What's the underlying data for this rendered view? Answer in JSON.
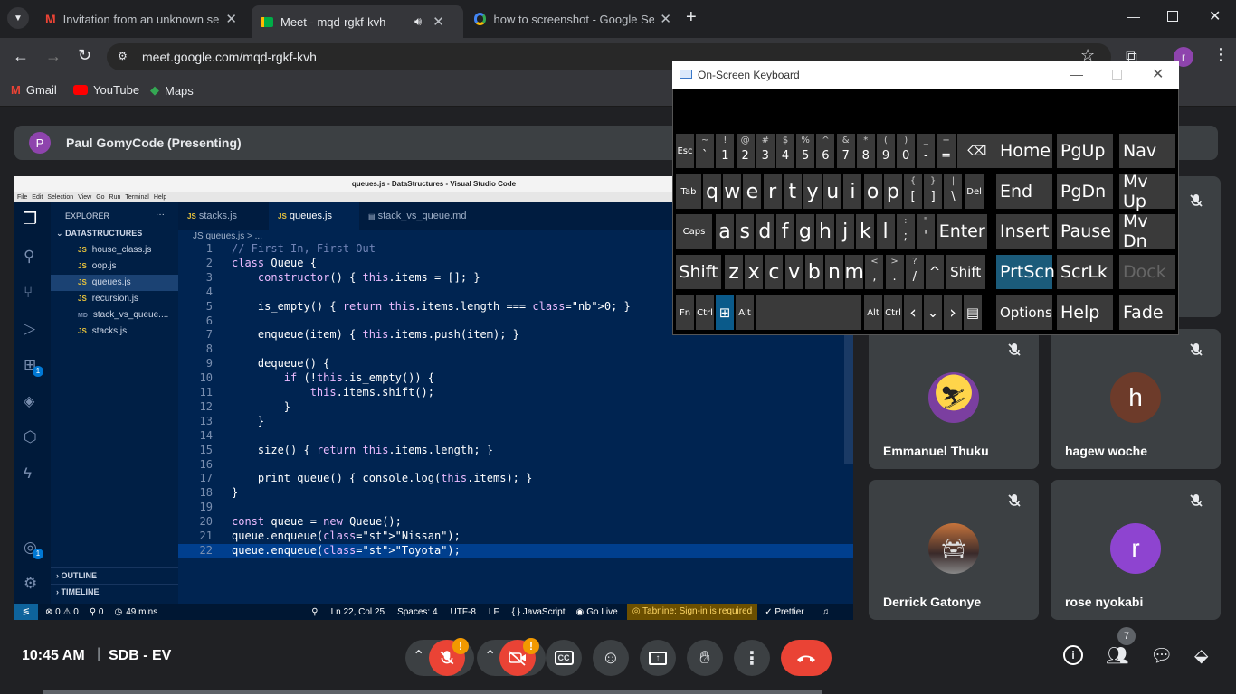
{
  "browser": {
    "tabs": [
      {
        "title": "Invitation from an unknown ser"
      },
      {
        "title": "Meet - mqd-rgkf-kvh"
      },
      {
        "title": "how to screenshot - Google Sea"
      }
    ],
    "url": "meet.google.com/mqd-rgkf-kvh",
    "profile_initial": "r",
    "bookmarks": [
      "Gmail",
      "YouTube",
      "Maps"
    ]
  },
  "meet": {
    "presenter_initial": "P",
    "presenting_label": "Paul GomyCode (Presenting)",
    "time": "10:45 AM",
    "meeting_code": "SDB - EV",
    "participants_count": "7",
    "participants": [
      {
        "name": "Emmanuel Thuku",
        "initial": ""
      },
      {
        "name": "hagew woche",
        "initial": "h"
      },
      {
        "name": "Derrick Gatonye",
        "initial": ""
      },
      {
        "name": "rose nyokabi",
        "initial": "r"
      }
    ],
    "warning_badge": "!"
  },
  "vscode": {
    "window_title": "queues.js - DataStructures - Visual Studio Code",
    "menu": [
      "File",
      "Edit",
      "Selection",
      "View",
      "Go",
      "Run",
      "Terminal",
      "Help"
    ],
    "explorer_label": "EXPLORER",
    "explorer_more": "···",
    "folder": "DATASTRUCTURES",
    "files": [
      "house_class.js",
      "oop.js",
      "queues.js",
      "recursion.js",
      "stack_vs_queue....",
      "stacks.js"
    ],
    "file_types": [
      "JS",
      "JS",
      "JS",
      "JS",
      "MD",
      "JS"
    ],
    "outline": "OUTLINE",
    "timeline": "TIMELINE",
    "editor_tabs": [
      "stacks.js",
      "queues.js",
      "stack_vs_queue.md"
    ],
    "breadcrumb": "JS queues.js > ...",
    "badge_ext": "1",
    "badge_account": "1",
    "code_lines": [
      "// First In, First Out",
      "class Queue {",
      "    constructor() { this.items = []; }",
      "",
      "    is_empty() { return this.items.length === 0; }",
      "",
      "    enqueue(item) { this.items.push(item); }",
      "",
      "    dequeue() {",
      "        if (!this.is_empty()) {",
      "            this.items.shift();",
      "        }",
      "    }",
      "",
      "    size() { return this.items.length; }",
      "",
      "    print queue() { console.log(this.items); }",
      "}",
      "",
      "const queue = new Queue();",
      "queue.enqueue(\"Nissan\");",
      "queue.enqueue(\"Toyota\");"
    ],
    "status": {
      "errors": "⊗ 0 ⚠ 0",
      "ports": "⚲ 0",
      "time": "49 mins",
      "position": "Ln 22, Col 25",
      "spaces": "Spaces: 4",
      "encoding": "UTF-8",
      "eol": "LF",
      "language": "{ } JavaScript",
      "golive": "Go Live",
      "tabnine": "Tabnine: Sign-in is required",
      "prettier": "✓ Prettier"
    }
  },
  "osk": {
    "title": "On-Screen Keyboard",
    "num_row": [
      {
        "top": "~",
        "bot": "`"
      },
      {
        "top": "!",
        "bot": "1"
      },
      {
        "top": "@",
        "bot": "2"
      },
      {
        "top": "#",
        "bot": "3"
      },
      {
        "top": "$",
        "bot": "4"
      },
      {
        "top": "%",
        "bot": "5"
      },
      {
        "top": "^",
        "bot": "6"
      },
      {
        "top": "&",
        "bot": "7"
      },
      {
        "top": "*",
        "bot": "8"
      },
      {
        "top": "(",
        "bot": "9"
      },
      {
        "top": ")",
        "bot": "0"
      },
      {
        "top": "_",
        "bot": "-"
      },
      {
        "top": "+",
        "bot": "="
      }
    ],
    "esc": "Esc",
    "row_q": [
      "q",
      "w",
      "e",
      "r",
      "t",
      "y",
      "u",
      "i",
      "o",
      "p"
    ],
    "row_q_extra": [
      {
        "top": "{",
        "bot": "["
      },
      {
        "top": "}",
        "bot": "]"
      },
      {
        "top": "|",
        "bot": "\\"
      }
    ],
    "row_a": [
      "a",
      "s",
      "d",
      "f",
      "g",
      "h",
      "j",
      "k",
      "l"
    ],
    "row_a_extra": [
      {
        "top": ":",
        "bot": ";"
      },
      {
        "top": "\"",
        "bot": "'"
      }
    ],
    "row_z": [
      "z",
      "x",
      "c",
      "v",
      "b",
      "n",
      "m"
    ],
    "row_z_extra": [
      {
        "top": "<",
        "bot": ","
      },
      {
        "top": ">",
        "bot": "."
      },
      {
        "top": "?",
        "bot": "/"
      }
    ],
    "tab": "Tab",
    "caps": "Caps",
    "shift": "Shift",
    "enter": "Enter",
    "del": "Del",
    "fn": "Fn",
    "ctrl": "Ctrl",
    "alt": "Alt",
    "nav_keys": [
      "Home",
      "PgUp",
      "Nav",
      "End",
      "PgDn",
      "Mv Up",
      "Insert",
      "Pause",
      "Mv Dn",
      "PrtScn",
      "ScrLk",
      "Dock",
      "Options",
      "Help",
      "Fade"
    ]
  },
  "colors": {
    "accent": "#1a73e8",
    "hangup": "#ea4335",
    "prtscn_active": "#1b5b7a",
    "warning": "#f29900"
  }
}
